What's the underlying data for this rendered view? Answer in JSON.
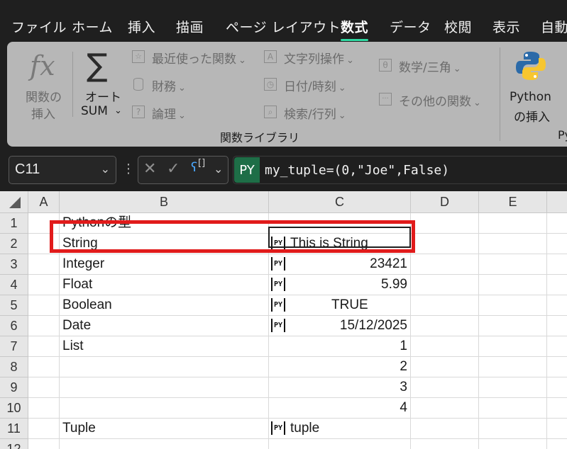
{
  "menu": {
    "tabs": [
      "ファイル",
      "ホーム",
      "挿入",
      "描画",
      "ページ レイアウト",
      "数式",
      "データ",
      "校閲",
      "表示",
      "自動"
    ],
    "active": "数式"
  },
  "ribbon": {
    "insert_function": {
      "line1": "関数の",
      "line2": "挿入"
    },
    "autosum": {
      "line1": "オート",
      "line2": "SUM"
    },
    "col1": [
      "最近使った関数",
      "財務",
      "論理"
    ],
    "col2": [
      "文字列操作",
      "日付/時刻",
      "検索/行列"
    ],
    "col3": [
      "数学/三角",
      "その他の関数"
    ],
    "group_label": "関数ライブラリ",
    "python": {
      "line1": "Python",
      "line2": "の挿入"
    },
    "python_group_label": "Py"
  },
  "formula_bar": {
    "name_box": "C11",
    "py_badge": "PY",
    "formula": "my_tuple=(0,\"Joe\",False)"
  },
  "sheet": {
    "columns": [
      "A",
      "B",
      "C",
      "D",
      "E"
    ],
    "rows": [
      {
        "num": "1",
        "b": "Pythonの型",
        "c": "",
        "c_py": false,
        "c_align": "left"
      },
      {
        "num": "2",
        "b": "String",
        "c": "This is String",
        "c_py": true,
        "c_align": "left"
      },
      {
        "num": "3",
        "b": "Integer",
        "c": "23421",
        "c_py": true,
        "c_align": "right"
      },
      {
        "num": "4",
        "b": "Float",
        "c": "5.99",
        "c_py": true,
        "c_align": "right"
      },
      {
        "num": "5",
        "b": "Boolean",
        "c": "TRUE",
        "c_py": true,
        "c_align": "center"
      },
      {
        "num": "6",
        "b": "Date",
        "c": "15/12/2025",
        "c_py": true,
        "c_align": "right"
      },
      {
        "num": "7",
        "b": "List",
        "c": "1",
        "c_py": false,
        "c_align": "right"
      },
      {
        "num": "8",
        "b": "",
        "c": "2",
        "c_py": false,
        "c_align": "right"
      },
      {
        "num": "9",
        "b": "",
        "c": "3",
        "c_py": false,
        "c_align": "right"
      },
      {
        "num": "10",
        "b": "",
        "c": "4",
        "c_py": false,
        "c_align": "right"
      },
      {
        "num": "11",
        "b": "Tuple",
        "c": "tuple",
        "c_py": true,
        "c_align": "left"
      },
      {
        "num": "12",
        "b": "",
        "c": "",
        "c_py": false,
        "c_align": "left"
      }
    ],
    "py_icon": "PY",
    "highlight_color": "#e11b1b"
  }
}
